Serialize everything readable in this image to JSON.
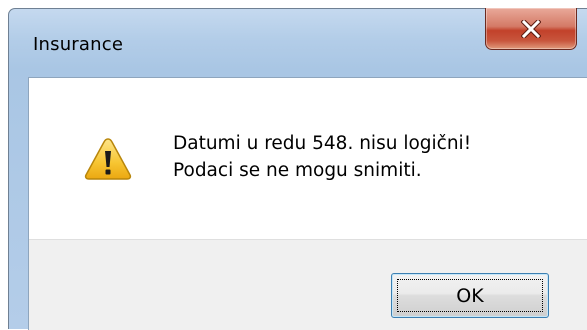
{
  "window": {
    "title": "Insurance",
    "close_icon": "close-x-icon",
    "close_color": "#c8462f"
  },
  "dialog": {
    "icon": "warning-icon",
    "message_lines": [
      "Datumi u redu 548. nisu logični!",
      "Podaci se ne mogu snimiti."
    ],
    "ok_label": "OK"
  }
}
